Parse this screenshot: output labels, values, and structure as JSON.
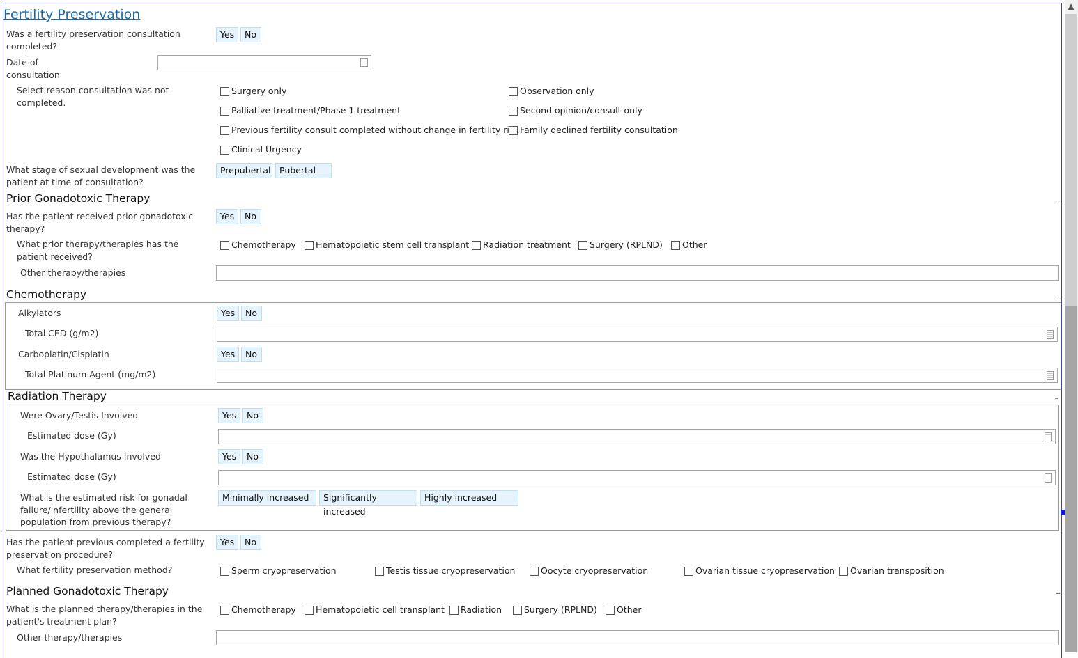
{
  "title": "Fertility Preservation",
  "yes": "Yes",
  "no": "No",
  "q_consult": "Was a fertility preservation consultation completed?",
  "q_date": "Date of consultation",
  "q_reason": "Select reason consultation was not completed.",
  "reasons": {
    "surgery_only": "Surgery only",
    "observation_only": "Observation only",
    "palliative": "Palliative treatment/Phase 1 treatment",
    "second_opinion": "Second opinion/consult only",
    "previous_consult": "Previous fertility consult completed without change in fertility risk",
    "family_declined": "Family declined fertility consultation",
    "clinical_urgency": "Clinical Urgency"
  },
  "q_stage": "What stage of sexual development was the patient at time of consultation?",
  "stage_options": {
    "prepubertal": "Prepubertal",
    "pubertal": "Pubertal"
  },
  "sec_prior": "Prior Gonadotoxic Therapy",
  "q_prior": "Has the patient received prior gonadotoxic therapy?",
  "q_prior_which": "What prior therapy/therapies has the patient received?",
  "prior_options": {
    "chemo": "Chemotherapy",
    "hsct": "Hematopoietic stem cell transplant",
    "radiation": "Radiation treatment",
    "surgery": "Surgery (RPLND)",
    "other": "Other"
  },
  "q_other_therapy": "Other therapy/therapies",
  "sec_chemo": "Chemotherapy",
  "q_alkylators": "Alkylators",
  "q_total_ced": "Total CED (g/m2)",
  "q_carbo": "Carboplatin/Cisplatin",
  "q_total_platinum": "Total Platinum Agent (mg/m2)",
  "sec_radiation": "Radiation Therapy",
  "q_ovary": "Were Ovary/Testis Involved",
  "q_est_dose": "Estimated dose (Gy)",
  "q_hypothalamus": "Was the Hypothalamus Involved",
  "q_risk": "What is the estimated risk for gonadal failure/infertility above the general population from previous therapy?",
  "risk_options": {
    "minimal": "Minimally increased",
    "significant": "Significantly increased",
    "high": "Highly increased"
  },
  "q_prev_procedure": "Has the patient previous completed a fertility preservation procedure?",
  "q_method": "What fertility preservation method?",
  "method_options": {
    "sperm": "Sperm cryopreservation",
    "testis": "Testis tissue cryopreservation",
    "oocyte": "Oocyte cryopreservation",
    "ovarian_tissue": "Ovarian tissue cryopreservation",
    "transposition": "Ovarian transposition"
  },
  "sec_planned": "Planned Gonadotoxic Therapy",
  "q_planned": "What is the planned therapy/therapies in the patient's treatment plan?",
  "planned_options": {
    "chemo": "Chemotherapy",
    "hct": "Hematopoietic cell transplant",
    "radiation": "Radiation",
    "surgery": "Surgery (RPLND)",
    "other": "Other"
  },
  "q_other_therapy2": "Other therapy/therapies"
}
